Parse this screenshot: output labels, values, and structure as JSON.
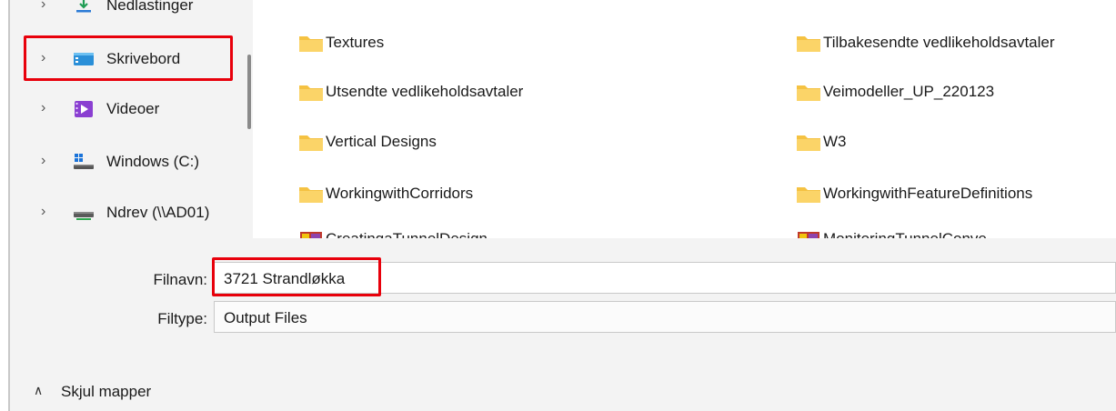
{
  "nav": {
    "items": [
      {
        "label": "Nedlastinger",
        "icon": "download-icon"
      },
      {
        "label": "Skrivebord",
        "icon": "desktop-icon"
      },
      {
        "label": "Videoer",
        "icon": "videos-icon"
      },
      {
        "label": "Windows  (C:)",
        "icon": "windows-drive-icon"
      },
      {
        "label": "Ndrev (\\\\AD01)",
        "icon": "network-drive-icon"
      }
    ],
    "expand_glyph": "›"
  },
  "files": {
    "col1": [
      "Textures",
      "Utsendte vedlikeholdsavtaler",
      "Vertical Designs",
      "WorkingwithCorridors",
      "CreatingaTunnelDesign"
    ],
    "col2": [
      "Tilbakesendte vedlikeholdsavtaler",
      "Veimodeller_UP_220123",
      "W3",
      "WorkingwithFeatureDefinitions",
      "MonitoringTunnelConve"
    ]
  },
  "form": {
    "filename_label": "Filnavn:",
    "filename_value": "3721 Strandløkka",
    "filetype_label": "Filtype:",
    "filetype_value": "Output Files"
  },
  "footer": {
    "hide_folders_label": "Skjul mapper",
    "hide_folders_glyph": "∧"
  },
  "colors": {
    "highlight": "#e8000b",
    "folder": "#f5c242",
    "pane_bg": "#f3f3f3"
  }
}
